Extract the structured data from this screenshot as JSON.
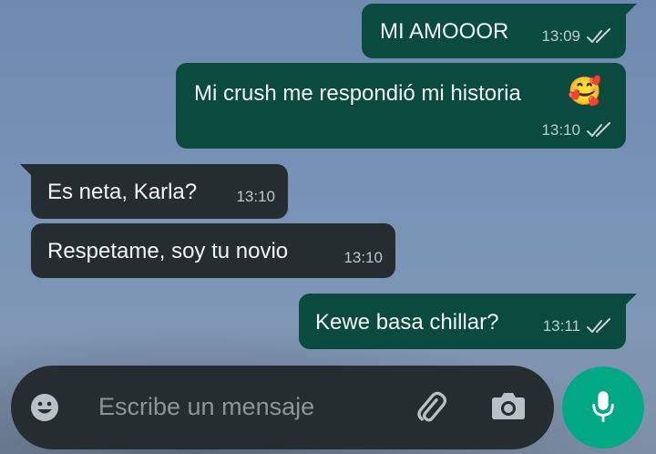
{
  "colors": {
    "outgoing_bubble": "#0b4a3e",
    "incoming_bubble": "#262d31",
    "accent": "#00a884",
    "read_ticks": "#c9d3d6"
  },
  "messages": [
    {
      "direction": "outgoing",
      "text": "MI AMOOOR",
      "time": "13:09",
      "status": "read-ticks-icon"
    },
    {
      "direction": "outgoing",
      "text": "Mi crush me respondió mi historia",
      "emoji": "🥰",
      "time": "13:10",
      "status": "read-ticks-icon"
    },
    {
      "direction": "incoming",
      "text": "Es neta, Karla?",
      "time": "13:10"
    },
    {
      "direction": "incoming",
      "text": "Respetame, soy tu novio",
      "time": "13:10"
    },
    {
      "direction": "outgoing",
      "text": "Kewe basa chillar?",
      "time": "13:11",
      "status": "read-ticks-icon"
    }
  ],
  "composer": {
    "placeholder": "Escribe un mensaje",
    "left_icon": "emoji-icon",
    "right_icons": [
      "attach-icon",
      "camera-icon"
    ]
  },
  "send_button": {
    "icon": "mic-icon"
  }
}
